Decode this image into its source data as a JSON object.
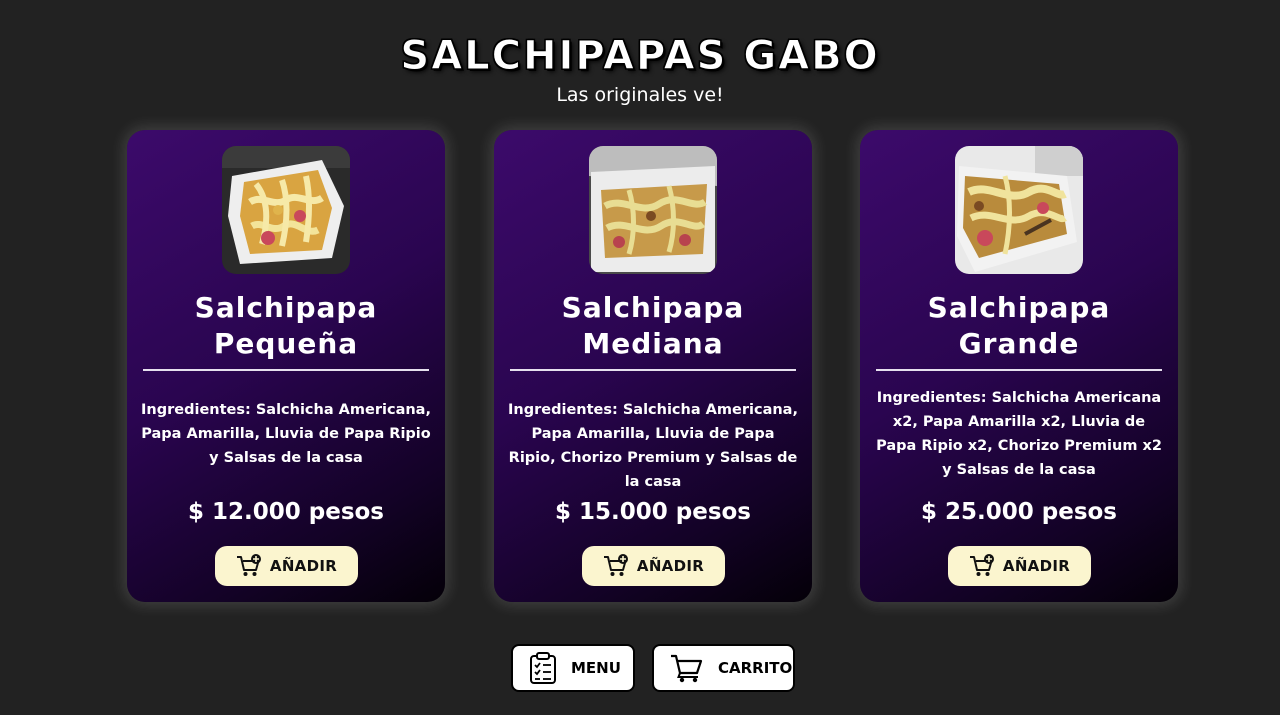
{
  "header": {
    "brand": "SALCHIPAPAS GABO",
    "tagline": "Las originales ve!"
  },
  "products": [
    {
      "title_line1": "Salchipapa",
      "title_line2": "Pequeña",
      "ingredients": "Ingredientes: Salchicha Americana, Papa Amarilla, Lluvia de Papa Ripio y Salsas de la casa",
      "price": "$ 12.000 pesos",
      "add_label": "AÑADIR",
      "photo_icon": "salchipapa-photo"
    },
    {
      "title_line1": "Salchipapa",
      "title_line2": "Mediana",
      "ingredients": "Ingredientes: Salchicha Americana, Papa Amarilla, Lluvia de Papa Ripio, Chorizo Premium y Salsas de la casa",
      "price": "$ 15.000 pesos",
      "add_label": "AÑADIR",
      "photo_icon": "salchipapa-photo"
    },
    {
      "title_line1": "Salchipapa",
      "title_line2": "Grande",
      "ingredients": "Ingredientes: Salchicha Americana x2, Papa Amarilla x2, Lluvia de Papa Ripio x2, Chorizo Premium x2 y Salsas de la casa",
      "price": "$ 25.000 pesos",
      "add_label": "AÑADIR",
      "photo_icon": "salchipapa-photo"
    }
  ],
  "nav": {
    "menu_label": "MENU",
    "menu_icon": "clipboard-checklist-icon",
    "cart_label": "CARRITO",
    "cart_icon": "shopping-cart-icon"
  },
  "colors": {
    "page_background": "#222222",
    "card_gradient_start": "#3c0a6b",
    "card_gradient_end": "#040008",
    "add_button": "#fbf5cf",
    "text": "#ffffff"
  }
}
